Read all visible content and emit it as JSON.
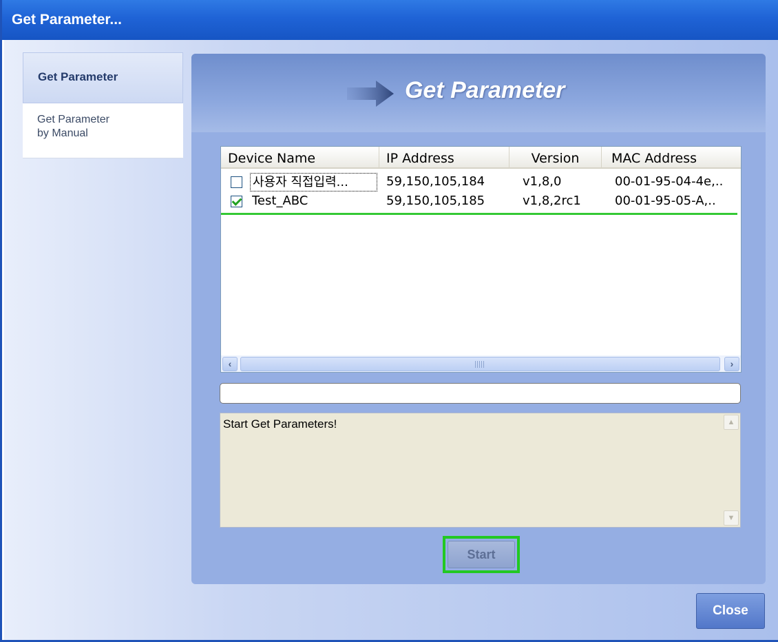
{
  "window": {
    "title": "Get Parameter..."
  },
  "sidebar": {
    "items": [
      {
        "label": "Get Parameter"
      },
      {
        "label_line1": "Get Parameter",
        "label_line2": "by Manual"
      }
    ]
  },
  "header": {
    "title": "Get Parameter",
    "icon": "arrow-right-icon"
  },
  "device_list": {
    "columns": [
      "Device Name",
      "IP Address",
      "Version",
      "MAC Address"
    ],
    "rows": [
      {
        "checked": false,
        "name": "사용자 직접입력...",
        "ip": "59,150,105,184",
        "version": "v1,8,0",
        "mac": "00-01-95-04-4e,.."
      },
      {
        "checked": true,
        "name": "Test_ABC",
        "ip": "59,150,105,185",
        "version": "v1,8,2rc1",
        "mac": "00-01-95-05-A,.."
      }
    ]
  },
  "progress": {
    "value": 0
  },
  "log": {
    "text": "Start Get Parameters!"
  },
  "buttons": {
    "start": "Start",
    "close": "Close"
  },
  "colors": {
    "titlebar": "#1f63d6",
    "highlight": "#22c922",
    "panel": "#95aee3"
  }
}
